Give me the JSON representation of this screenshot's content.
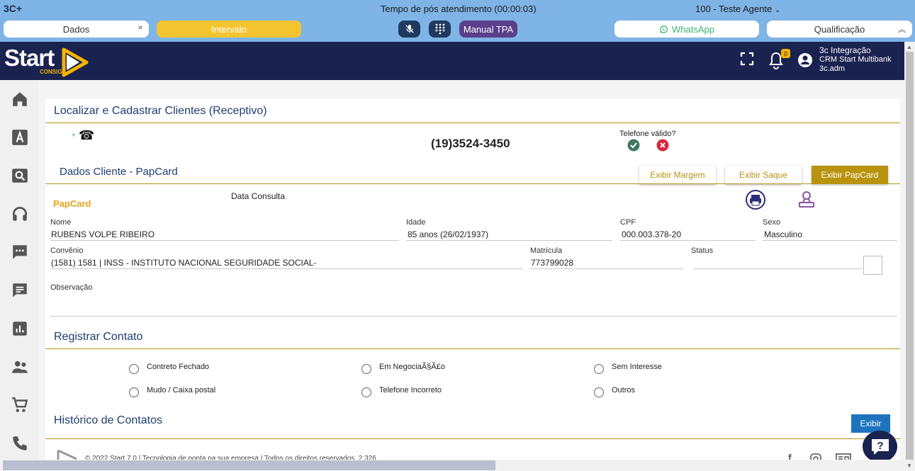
{
  "topbar": {
    "logo": "3C+",
    "status_text": "Tempo de pós atendimento (00:00:03)",
    "agent": "100 - Teste Agente",
    "dados_label": "Dados",
    "intervalo_label": "Intervalo",
    "manual_tpa_label": "Manual TPA",
    "whatsapp_label": "WhatsApp",
    "qualificacao_label": "Qualificação"
  },
  "header": {
    "brand": "Start",
    "brand_sub": "CONSIG",
    "notification_count": "0",
    "user_line1": "3c Integração",
    "user_line2": "CRM Start Multibank",
    "user_line3": "3c.adm"
  },
  "sidebar": {
    "items": [
      "home-icon",
      "font-icon",
      "search-icon",
      "headset-icon",
      "chat-icon",
      "notes-icon",
      "chart-icon",
      "people-icon",
      "cart-icon",
      "phone-icon"
    ]
  },
  "page": {
    "title": "Localizar e Cadastrar Clientes (Receptivo)",
    "phone_plus": "+",
    "phone_number": "(19)3524-3450",
    "telefone_valido_label": "Telefone válido?"
  },
  "cliente": {
    "section_title": "Dados Cliente - PapCard",
    "btn_margem": "Exibir Margem",
    "btn_saque": "Exibir Saque",
    "btn_papcard": "Exibir PapCard",
    "papcard_label": "PapCard",
    "data_consulta_label": "Data Consulta",
    "nome_label": "Nome",
    "nome": "RUBENS VOLPE RIBEIRO",
    "idade_label": "Idade",
    "idade": "85 anos (26/02/1937)",
    "cpf_label": "CPF",
    "cpf": "000.003.378-20",
    "sexo_label": "Sexo",
    "sexo": "Masculino",
    "convenio_label": "Convênio",
    "convenio": "(1581) 1581 | INSS - INSTITUTO NACIONAL SEGURIDADE SOCIAL-",
    "matricula_label": "Matrícula",
    "matricula": "773799028",
    "status_label": "Status",
    "status": "",
    "observacao_label": "Observação"
  },
  "contato": {
    "section_title": "Registrar Contato",
    "options": [
      "Contreto Fechado",
      "Em NegociaÃ§Ã£o",
      "Sem Interesse",
      "Mudo / Caixa postal",
      "Telefone Incorreto",
      "Outros"
    ]
  },
  "historico": {
    "section_title": "Histórico de Contatos",
    "exibir_label": "Exibir"
  },
  "footer": {
    "text": "© 2022 Start 7.0 | Tecnologia de ponta na sua empresa | Todos os direitos reservados. 2.326"
  },
  "colors": {
    "topbar": "#7fb4e6",
    "header": "#1a2250",
    "gold": "#b89312",
    "intervalo": "#f4c430",
    "manual_tpa": "#5a3f8a"
  }
}
